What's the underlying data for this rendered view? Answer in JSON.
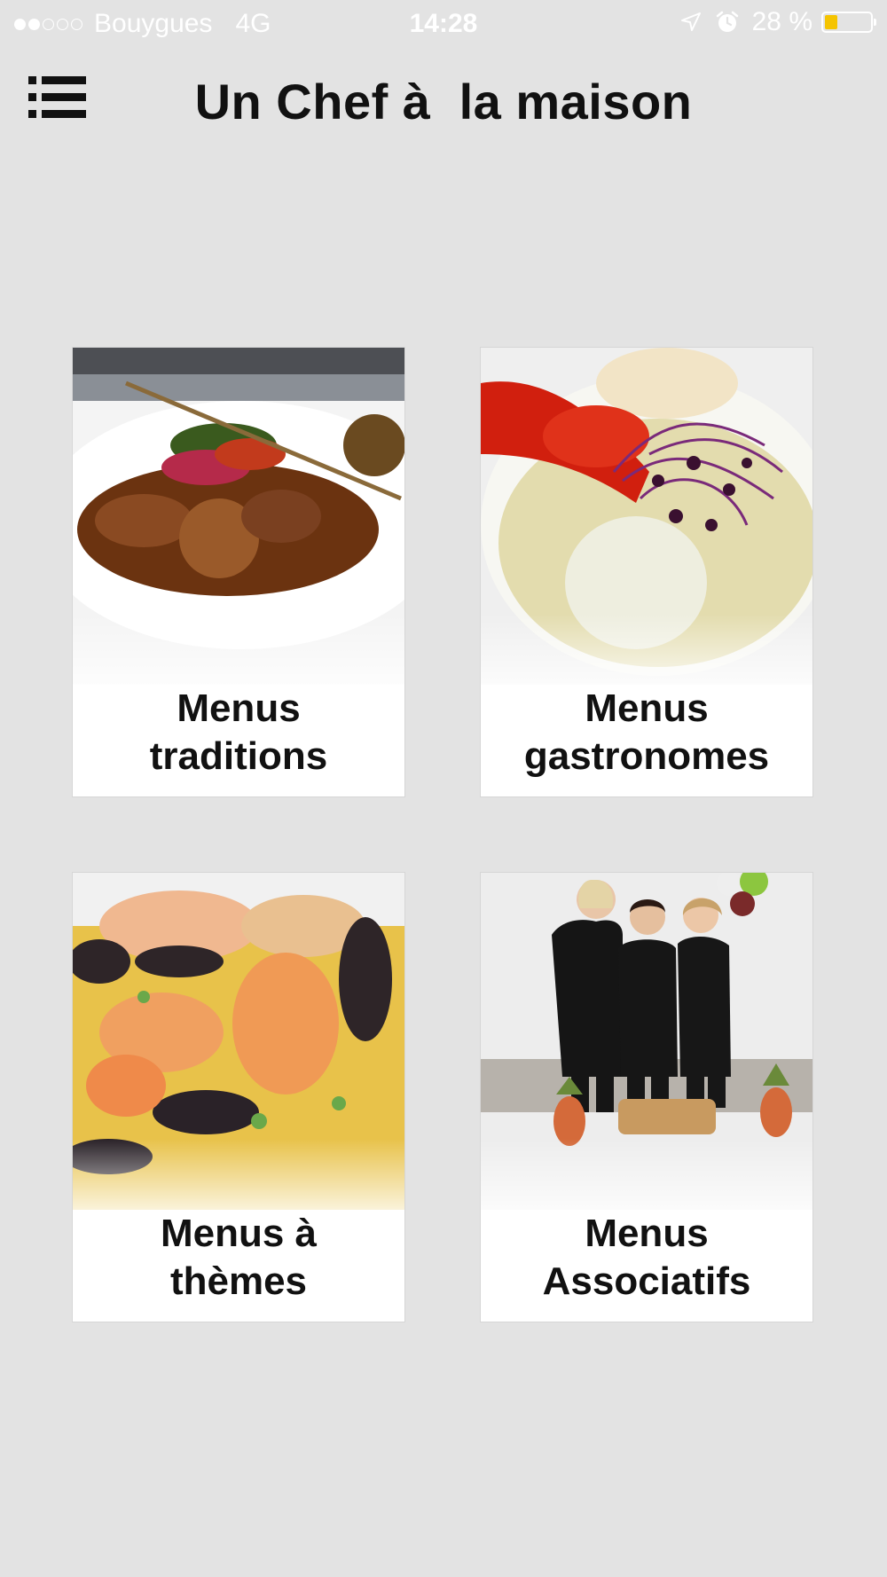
{
  "status_bar": {
    "carrier": "Bouygues",
    "network": "4G",
    "time": "14:28",
    "battery_percent_label": "28 %",
    "battery_level": 0.28,
    "battery_color": "#f5c400",
    "signal_dots": [
      "full",
      "full",
      "empty",
      "empty",
      "empty"
    ],
    "icons": [
      "location-arrow-icon",
      "alarm-clock-icon",
      "battery-icon"
    ]
  },
  "header": {
    "menu_icon": "list-menu-icon",
    "title": "Un Chef à  la maison"
  },
  "tiles": [
    {
      "line1": "Menus",
      "line2": "traditions",
      "image": "plated-meat-dish-photo"
    },
    {
      "line1": "Menus",
      "line2": "gastronomes",
      "image": "lobster-fish-dish-photo"
    },
    {
      "line1": "Menus à",
      "line2": "thèmes",
      "image": "paella-seafood-photo"
    },
    {
      "line1": "Menus",
      "line2": "Associatifs",
      "image": "catering-staff-photo"
    }
  ],
  "colors": {
    "background": "#e3e3e3",
    "tile_background": "#ffffff",
    "text": "#111111"
  }
}
